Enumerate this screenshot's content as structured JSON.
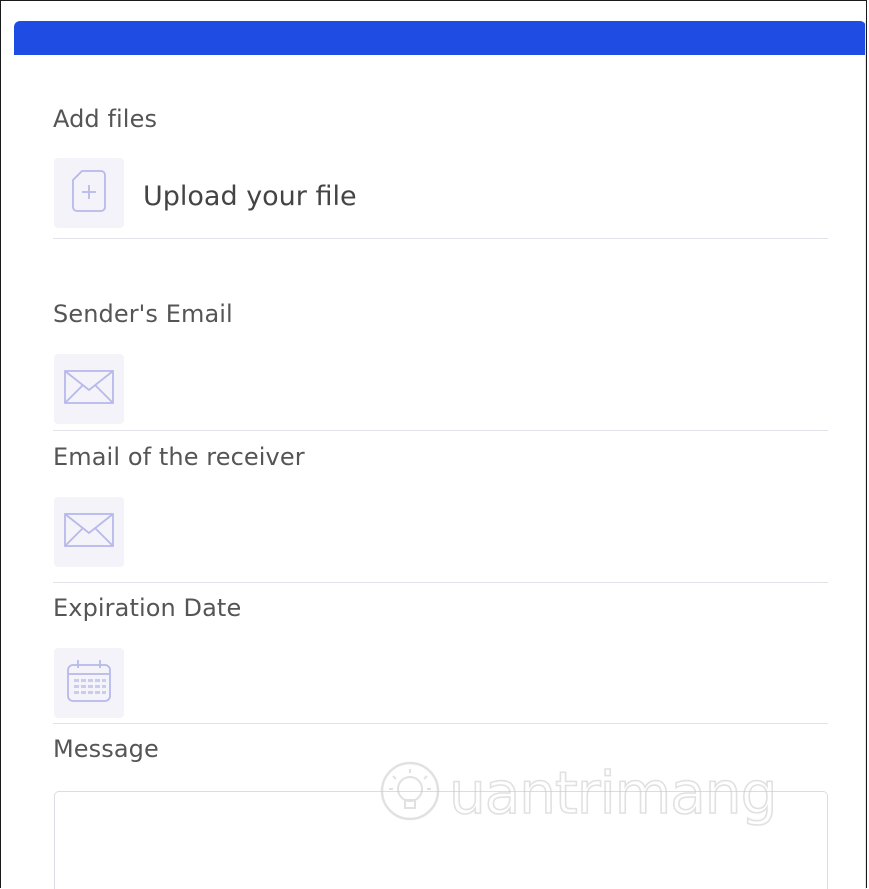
{
  "form": {
    "add_files_label": "Add files",
    "upload_text": "Upload your file",
    "sender_email_label": "Sender's Email",
    "sender_email_value": "",
    "receiver_email_label": "Email of the receiver",
    "receiver_email_value": "",
    "expiration_date_label": "Expiration Date",
    "expiration_date_value": "",
    "message_label": "Message",
    "message_value": ""
  },
  "watermark": {
    "text": "uantrimang"
  },
  "colors": {
    "header": "#1f4de4",
    "icon_tint": "#b7b9ea",
    "icon_bg": "#f3f3f9"
  },
  "icons": {
    "upload": "file-plus-icon",
    "sender": "envelope-icon",
    "receiver": "envelope-icon",
    "date": "calendar-icon"
  }
}
